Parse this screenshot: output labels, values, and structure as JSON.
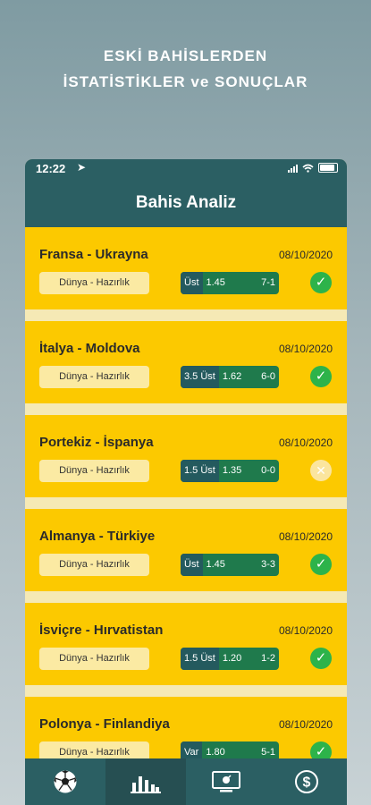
{
  "promo": {
    "line1": "ESKİ BAHİSLERDEN",
    "line2": "İSTATİSTİKLER ve SONUÇLAR"
  },
  "status_bar": {
    "time": "12:22"
  },
  "header": {
    "title": "Bahis Analiz"
  },
  "colors": {
    "primary": "#2b5f63",
    "card": "#fcc900",
    "win": "#2db34a",
    "bet_green": "#1f7a4c"
  },
  "matches": [
    {
      "teams": "Fransa - Ukrayna",
      "date": "08/10/2020",
      "league": "Dünya - Hazırlık",
      "bet_type": "Üst",
      "odd": "1.45",
      "score": "7-1",
      "result": "win",
      "result_icon": "✓"
    },
    {
      "teams": "İtalya - Moldova",
      "date": "08/10/2020",
      "league": "Dünya - Hazırlık",
      "bet_type": "3.5 Üst",
      "odd": "1.62",
      "score": "6-0",
      "result": "win",
      "result_icon": "✓"
    },
    {
      "teams": "Portekiz - İspanya",
      "date": "08/10/2020",
      "league": "Dünya - Hazırlık",
      "bet_type": "1.5 Üst",
      "odd": "1.35",
      "score": "0-0",
      "result": "lose",
      "result_icon": "✕"
    },
    {
      "teams": "Almanya - Türkiye",
      "date": "08/10/2020",
      "league": "Dünya - Hazırlık",
      "bet_type": "Üst",
      "odd": "1.45",
      "score": "3-3",
      "result": "win",
      "result_icon": "✓"
    },
    {
      "teams": "İsviçre - Hırvatistan",
      "date": "08/10/2020",
      "league": "Dünya - Hazırlık",
      "bet_type": "1.5 Üst",
      "odd": "1.20",
      "score": "1-2",
      "result": "win",
      "result_icon": "✓"
    },
    {
      "teams": "Polonya - Finlandiya",
      "date": "08/10/2020",
      "league": "Dünya - Hazırlık",
      "bet_type": "Var",
      "odd": "1.80",
      "score": "5-1",
      "result": "win",
      "result_icon": "✓"
    }
  ],
  "tabs": [
    {
      "icon": "soccer-ball-icon",
      "active": false
    },
    {
      "icon": "bar-chart-icon",
      "active": true
    },
    {
      "icon": "tv-icon",
      "active": false
    },
    {
      "icon": "dollar-icon",
      "active": false
    }
  ]
}
